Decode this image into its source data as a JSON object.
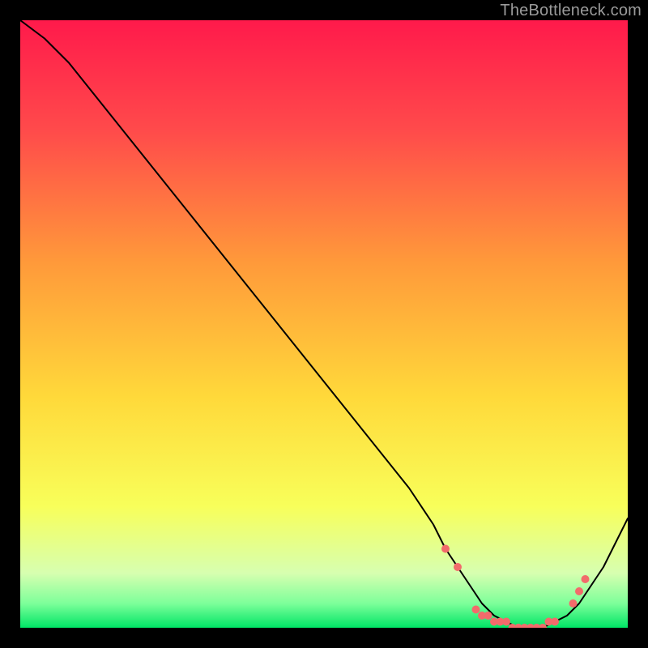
{
  "attribution": "TheBottleneck.com",
  "colors": {
    "gradient_stops": [
      {
        "offset": "0%",
        "color": "#ff1a4b"
      },
      {
        "offset": "18%",
        "color": "#ff4a4b"
      },
      {
        "offset": "40%",
        "color": "#ff9a3a"
      },
      {
        "offset": "62%",
        "color": "#ffd93a"
      },
      {
        "offset": "80%",
        "color": "#f8ff5a"
      },
      {
        "offset": "91%",
        "color": "#d7ffb0"
      },
      {
        "offset": "96%",
        "color": "#7dff9a"
      },
      {
        "offset": "100%",
        "color": "#00e566"
      }
    ],
    "curve": "#000000",
    "marker": "#f26b6b"
  },
  "chart_data": {
    "type": "line",
    "title": "",
    "xlabel": "",
    "ylabel": "",
    "xlim": [
      0,
      100
    ],
    "ylim": [
      0,
      100
    ],
    "series": [
      {
        "name": "curve",
        "x": [
          0,
          4,
          8,
          12,
          16,
          20,
          24,
          28,
          32,
          36,
          40,
          44,
          48,
          52,
          56,
          60,
          64,
          68,
          70,
          72,
          74,
          76,
          78,
          80,
          82,
          84,
          86,
          88,
          90,
          92,
          94,
          96,
          98,
          100
        ],
        "y": [
          100,
          97,
          93,
          88,
          83,
          78,
          73,
          68,
          63,
          58,
          53,
          48,
          43,
          38,
          33,
          28,
          23,
          17,
          13,
          10,
          7,
          4,
          2,
          1,
          0,
          0,
          0,
          1,
          2,
          4,
          7,
          10,
          14,
          18
        ]
      }
    ],
    "markers": {
      "color": "#f26b6b",
      "radius_px": 5,
      "points": [
        {
          "x": 70,
          "y": 13
        },
        {
          "x": 72,
          "y": 10
        },
        {
          "x": 75,
          "y": 3
        },
        {
          "x": 76,
          "y": 2
        },
        {
          "x": 77,
          "y": 2
        },
        {
          "x": 78,
          "y": 1
        },
        {
          "x": 79,
          "y": 1
        },
        {
          "x": 80,
          "y": 1
        },
        {
          "x": 81,
          "y": 0
        },
        {
          "x": 82,
          "y": 0
        },
        {
          "x": 83,
          "y": 0
        },
        {
          "x": 84,
          "y": 0
        },
        {
          "x": 85,
          "y": 0
        },
        {
          "x": 86,
          "y": 0
        },
        {
          "x": 87,
          "y": 1
        },
        {
          "x": 88,
          "y": 1
        },
        {
          "x": 91,
          "y": 4
        },
        {
          "x": 92,
          "y": 6
        },
        {
          "x": 93,
          "y": 8
        }
      ]
    }
  }
}
